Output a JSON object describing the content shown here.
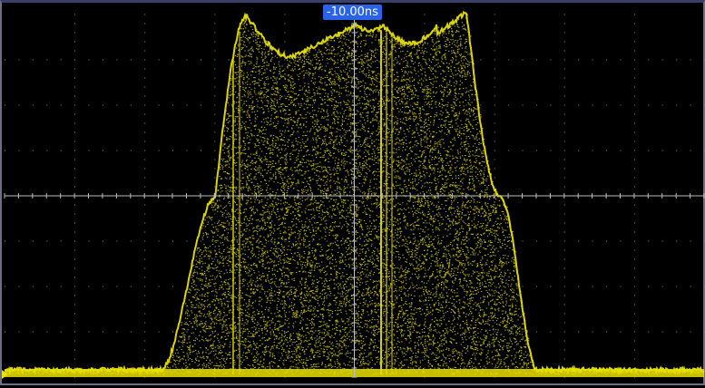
{
  "timebase": {
    "trigger_position_label": "-10.00ns"
  },
  "waveform": {
    "channel_color": "#e8e000",
    "grid_color": "#8a8a8a",
    "background_color": "#000000",
    "marker_color": "#2a62e8"
  }
}
